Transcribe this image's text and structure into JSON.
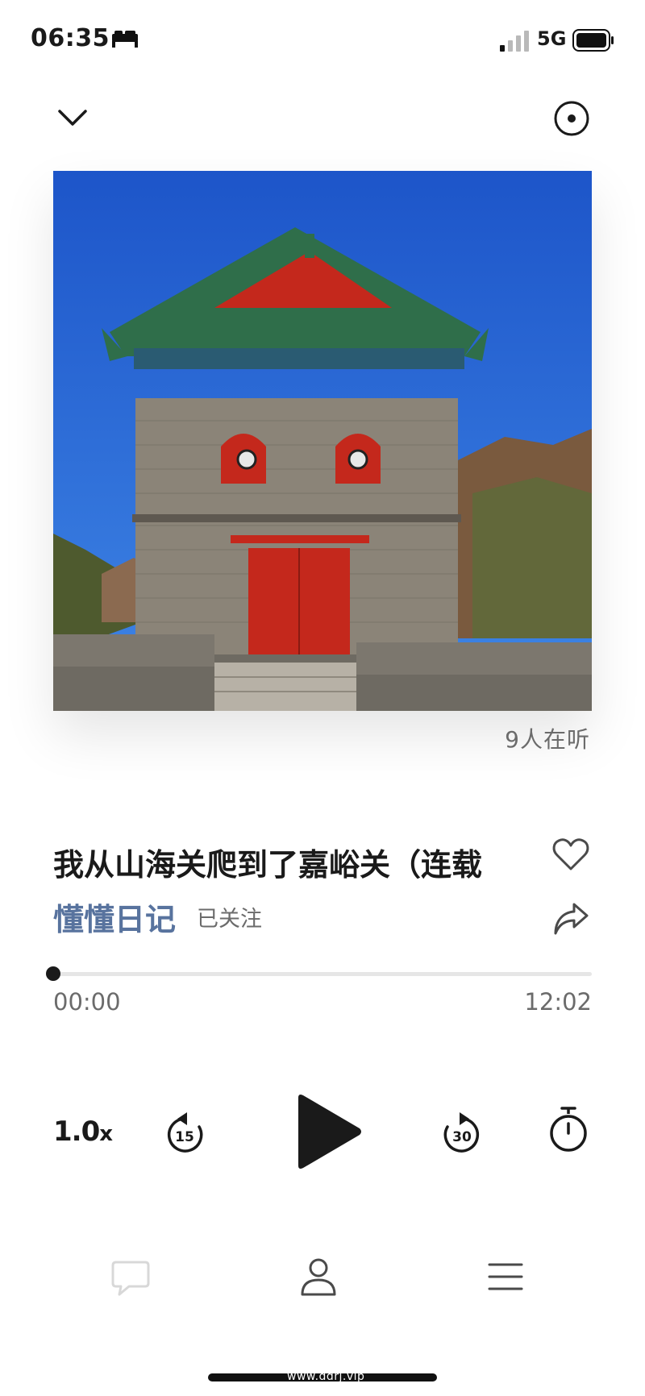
{
  "status_bar": {
    "time": "06:35",
    "sleep_icon": "bed-icon",
    "network": "5G",
    "signal_icon": "signal-icon",
    "battery_icon": "battery-icon"
  },
  "header": {
    "collapse_icon": "chevron-down-icon",
    "cast_icon": "cast-icon"
  },
  "episode": {
    "listeners": "9人在听",
    "title": "我从山海关爬到了嘉峪关（连载",
    "author": "懂懂日记",
    "follow_status": "已关注"
  },
  "progress": {
    "current": "00:00",
    "total": "12:02",
    "fraction": 0
  },
  "controls": {
    "speed_value": "1.0",
    "speed_unit": "x",
    "rewind_seconds": "15",
    "forward_seconds": "30"
  },
  "bottom_bar": {
    "comment_icon": "comment-icon",
    "profile_icon": "user-icon",
    "menu_icon": "menu-icon"
  },
  "watermark": "www.ddrj.vip",
  "colors": {
    "author": "#58739e",
    "secondary_text": "#6b6b6b",
    "primary_text": "#1a1a1a",
    "sky": "#1f5fd0",
    "door_red": "#c4281c"
  }
}
